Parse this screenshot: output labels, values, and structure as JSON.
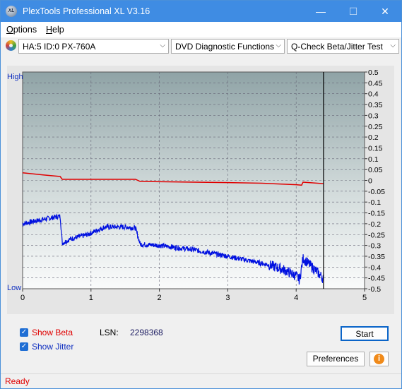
{
  "window": {
    "title": "PlexTools Professional XL V3.16",
    "icon_label": "XL",
    "minimize": "—",
    "maximize": "☐",
    "close": "✕"
  },
  "menu": {
    "options": "Options",
    "options_key": "O",
    "options_rest": "ptions",
    "help_key": "H",
    "help_rest": "elp"
  },
  "toolbar": {
    "drive": "HA:5 ID:0  PX-760A",
    "function": "DVD Diagnostic Functions",
    "test": "Q-Check Beta/Jitter Test",
    "arrow": "⌵"
  },
  "chart_data": {
    "type": "line",
    "left_axis": {
      "top_label": "High",
      "bottom_label": "Low"
    },
    "x_ticks": [
      "0",
      "1",
      "2",
      "3",
      "4",
      "5"
    ],
    "xlim": [
      0,
      5
    ],
    "right_ticks": [
      "0.5",
      "0.45",
      "0.4",
      "0.35",
      "0.3",
      "0.25",
      "0.2",
      "0.15",
      "0.1",
      "0.05",
      "0",
      "-0.05",
      "-0.1",
      "-0.15",
      "-0.2",
      "-0.25",
      "-0.3",
      "-0.35",
      "-0.4",
      "-0.45",
      "-0.5"
    ],
    "ylim": [
      -0.5,
      0.5
    ],
    "end_marker_x": 4.4,
    "grid": true,
    "series": [
      {
        "color": "#e00000",
        "x": [
          0,
          0.3,
          0.55,
          0.58,
          1.0,
          1.65,
          1.72,
          2.5,
          3.0,
          3.5,
          4.0,
          4.08,
          4.1,
          4.4
        ],
        "y": [
          0.035,
          0.025,
          0.018,
          0.005,
          0.005,
          0.005,
          -0.005,
          -0.008,
          -0.01,
          -0.013,
          -0.02,
          -0.022,
          -0.008,
          -0.015
        ]
      },
      {
        "color": "#0010e0",
        "x": [
          0,
          0.3,
          0.55,
          0.58,
          0.7,
          0.95,
          1.2,
          1.5,
          1.65,
          1.72,
          2.0,
          2.5,
          3.0,
          3.3,
          3.6,
          3.8,
          4.0,
          4.05,
          4.1,
          4.2,
          4.3,
          4.4
        ],
        "y": [
          -0.2,
          -0.18,
          -0.165,
          -0.29,
          -0.27,
          -0.25,
          -0.215,
          -0.215,
          -0.22,
          -0.295,
          -0.3,
          -0.32,
          -0.35,
          -0.37,
          -0.39,
          -0.41,
          -0.44,
          -0.46,
          -0.36,
          -0.39,
          -0.42,
          -0.455
        ]
      }
    ]
  },
  "options": {
    "show_beta": "Show Beta",
    "show_beta_key": "B",
    "show_jitter": "Show Jitter",
    "show_jitter_key": "J",
    "lsn_label": "LSN:",
    "lsn_value": "2298368",
    "check_mark": "✓",
    "beta_color": "#e00000",
    "jitter_color": "#1030c0"
  },
  "buttons": {
    "start": "Start",
    "preferences": "Preferences",
    "info": "i"
  },
  "status": {
    "text": "Ready",
    "color": "#e00000"
  }
}
